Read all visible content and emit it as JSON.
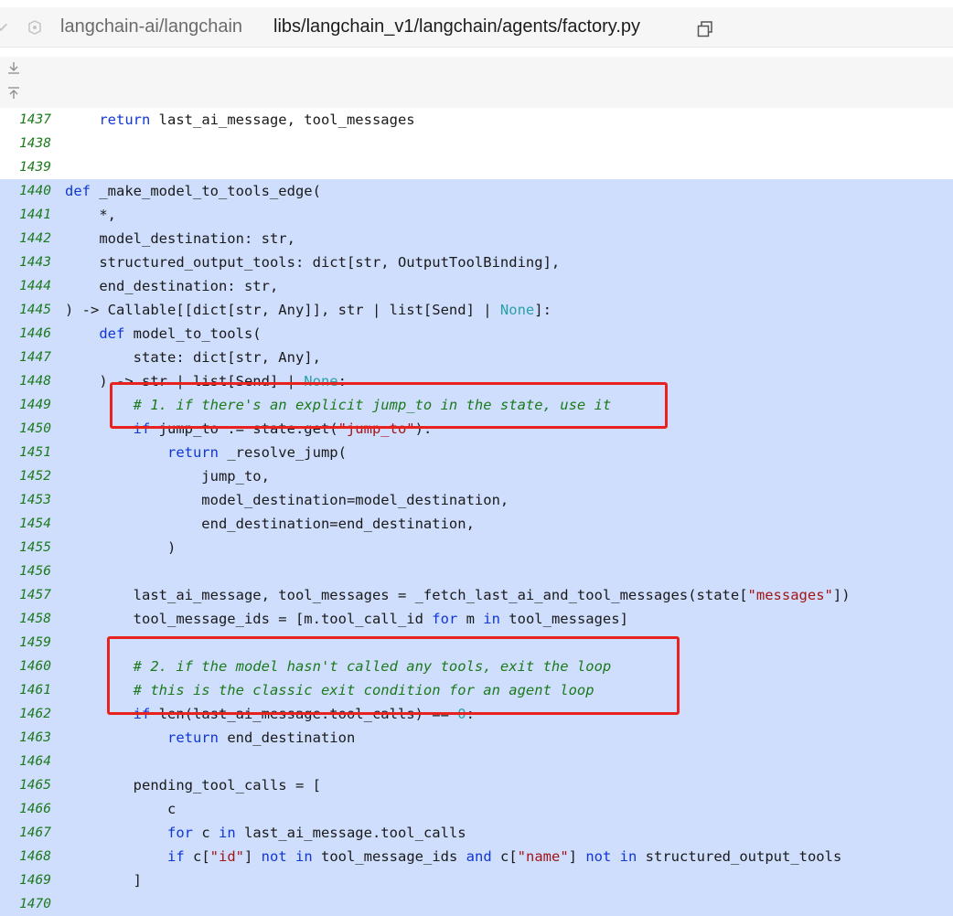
{
  "header": {
    "repo": "langchain-ai/langchain",
    "path": "libs/langchain_v1/langchain/agents/factory.py"
  },
  "icons": {
    "collapse": "chevron-down-icon",
    "repo": "repo-icon",
    "copy": "copy-icon",
    "expand_down": "expand-down-icon",
    "expand_up": "expand-up-icon"
  },
  "colors": {
    "highlight": "#cfdefd",
    "keyword": "#1036d6",
    "comment": "#1b7a1b",
    "string": "#a31515",
    "annotation_box": "#e8231f"
  },
  "code": {
    "lines": [
      {
        "n": "1437",
        "hl": false,
        "t": [
          [
            "    ",
            ""
          ],
          [
            "return",
            "kw"
          ],
          [
            " last_ai_message, tool_messages",
            ""
          ]
        ]
      },
      {
        "n": "1438",
        "hl": false,
        "t": []
      },
      {
        "n": "1439",
        "hl": false,
        "t": []
      },
      {
        "n": "1440",
        "hl": true,
        "t": [
          [
            "def",
            "kw"
          ],
          [
            " _make_model_to_tools_edge(",
            ""
          ]
        ]
      },
      {
        "n": "1441",
        "hl": true,
        "t": [
          [
            "    *,",
            ""
          ]
        ]
      },
      {
        "n": "1442",
        "hl": true,
        "t": [
          [
            "    model_destination: str,",
            ""
          ]
        ]
      },
      {
        "n": "1443",
        "hl": true,
        "t": [
          [
            "    structured_output_tools: dict[str, OutputToolBinding],",
            ""
          ]
        ]
      },
      {
        "n": "1444",
        "hl": true,
        "t": [
          [
            "    end_destination: str,",
            ""
          ]
        ]
      },
      {
        "n": "1445",
        "hl": true,
        "t": [
          [
            ") -> Callable[[dict[str, Any]], str | list[Send] | ",
            ""
          ],
          [
            "None",
            "nn"
          ],
          [
            "]:",
            ""
          ]
        ]
      },
      {
        "n": "1446",
        "hl": true,
        "t": [
          [
            "    ",
            ""
          ],
          [
            "def",
            "kw"
          ],
          [
            " model_to_tools(",
            ""
          ]
        ]
      },
      {
        "n": "1447",
        "hl": true,
        "t": [
          [
            "        state: dict[str, Any],",
            ""
          ]
        ]
      },
      {
        "n": "1448",
        "hl": true,
        "t": [
          [
            "    ) -> str | list[Send] | ",
            ""
          ],
          [
            "None",
            "nn"
          ],
          [
            ":",
            ""
          ]
        ]
      },
      {
        "n": "1449",
        "hl": true,
        "t": [
          [
            "        ",
            ""
          ],
          [
            "# 1. if there's an explicit jump_to in the state, use it",
            "cm"
          ]
        ]
      },
      {
        "n": "1450",
        "hl": true,
        "t": [
          [
            "        ",
            ""
          ],
          [
            "if",
            "kw"
          ],
          [
            " jump_to := state.get(",
            ""
          ],
          [
            "\"jump_to\"",
            "st"
          ],
          [
            "):",
            ""
          ]
        ]
      },
      {
        "n": "1451",
        "hl": true,
        "t": [
          [
            "            ",
            ""
          ],
          [
            "return",
            "kw"
          ],
          [
            " _resolve_jump(",
            ""
          ]
        ]
      },
      {
        "n": "1452",
        "hl": true,
        "t": [
          [
            "                jump_to,",
            ""
          ]
        ]
      },
      {
        "n": "1453",
        "hl": true,
        "t": [
          [
            "                model_destination=model_destination,",
            ""
          ]
        ]
      },
      {
        "n": "1454",
        "hl": true,
        "t": [
          [
            "                end_destination=end_destination,",
            ""
          ]
        ]
      },
      {
        "n": "1455",
        "hl": true,
        "t": [
          [
            "            )",
            ""
          ]
        ]
      },
      {
        "n": "1456",
        "hl": true,
        "t": []
      },
      {
        "n": "1457",
        "hl": true,
        "t": [
          [
            "        last_ai_message, tool_messages = _fetch_last_ai_and_tool_messages(state[",
            ""
          ],
          [
            "\"messages\"",
            "st"
          ],
          [
            "])",
            ""
          ]
        ]
      },
      {
        "n": "1458",
        "hl": true,
        "t": [
          [
            "        tool_message_ids = [m.tool_call_id ",
            ""
          ],
          [
            "for",
            "kw"
          ],
          [
            " m ",
            ""
          ],
          [
            "in",
            "kw"
          ],
          [
            " tool_messages]",
            ""
          ]
        ]
      },
      {
        "n": "1459",
        "hl": true,
        "t": []
      },
      {
        "n": "1460",
        "hl": true,
        "t": [
          [
            "        ",
            ""
          ],
          [
            "# 2. if the model hasn't called any tools, exit the loop",
            "cm"
          ]
        ]
      },
      {
        "n": "1461",
        "hl": true,
        "t": [
          [
            "        ",
            ""
          ],
          [
            "# this is the classic exit condition for an agent loop",
            "cm"
          ]
        ]
      },
      {
        "n": "1462",
        "hl": true,
        "t": [
          [
            "        ",
            ""
          ],
          [
            "if",
            "kw"
          ],
          [
            " len(last_ai_message.tool_calls) == ",
            ""
          ],
          [
            "0",
            "nn"
          ],
          [
            ":",
            ""
          ]
        ]
      },
      {
        "n": "1463",
        "hl": true,
        "t": [
          [
            "            ",
            ""
          ],
          [
            "return",
            "kw"
          ],
          [
            " end_destination",
            ""
          ]
        ]
      },
      {
        "n": "1464",
        "hl": true,
        "t": []
      },
      {
        "n": "1465",
        "hl": true,
        "t": [
          [
            "        pending_tool_calls = [",
            ""
          ]
        ]
      },
      {
        "n": "1466",
        "hl": true,
        "t": [
          [
            "            c",
            ""
          ]
        ]
      },
      {
        "n": "1467",
        "hl": true,
        "t": [
          [
            "            ",
            ""
          ],
          [
            "for",
            "kw"
          ],
          [
            " c ",
            ""
          ],
          [
            "in",
            "kw"
          ],
          [
            " last_ai_message.tool_calls",
            ""
          ]
        ]
      },
      {
        "n": "1468",
        "hl": true,
        "t": [
          [
            "            ",
            ""
          ],
          [
            "if",
            "kw"
          ],
          [
            " c[",
            ""
          ],
          [
            "\"id\"",
            "st"
          ],
          [
            "] ",
            ""
          ],
          [
            "not",
            "kw"
          ],
          [
            " ",
            ""
          ],
          [
            "in",
            "kw"
          ],
          [
            " tool_message_ids ",
            ""
          ],
          [
            "and",
            "kw"
          ],
          [
            " c[",
            ""
          ],
          [
            "\"name\"",
            "st"
          ],
          [
            "] ",
            ""
          ],
          [
            "not",
            "kw"
          ],
          [
            " ",
            ""
          ],
          [
            "in",
            "kw"
          ],
          [
            " structured_output_tools",
            ""
          ]
        ]
      },
      {
        "n": "1469",
        "hl": true,
        "t": [
          [
            "        ]",
            ""
          ]
        ]
      },
      {
        "n": "1470",
        "hl": true,
        "t": []
      }
    ]
  }
}
